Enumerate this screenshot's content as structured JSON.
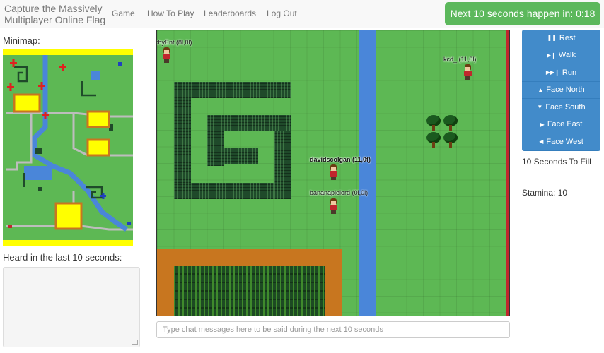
{
  "navbar": {
    "brand": "Capture the Massively Multiplayer Online Flag",
    "links": [
      "Game",
      "How To Play",
      "Leaderboards",
      "Log Out"
    ],
    "timer_label": "Next 10 seconds happen in:",
    "timer_value": "0:18"
  },
  "sidebar": {
    "minimap_label": "Minimap:",
    "heard_label": "Heard in the last 10 seconds:"
  },
  "map": {
    "players": [
      {
        "name": "AnarchyEnt",
        "coords": "(8l,0l)"
      },
      {
        "name": "kcd_",
        "coords": "(11,0l)"
      },
      {
        "name": "davidscolgan",
        "coords": "(11,0t)"
      },
      {
        "name": "bananapielord",
        "coords": "(0l,0l)"
      }
    ]
  },
  "chat": {
    "placeholder": "Type chat messages here to be said during the next 10 seconds"
  },
  "controls": {
    "buttons": [
      {
        "icon": "pause-icon",
        "label": "Rest"
      },
      {
        "icon": "step-forward-icon",
        "label": "Walk"
      },
      {
        "icon": "fast-forward-icon",
        "label": "Run"
      },
      {
        "icon": "chevron-up-icon",
        "label": "Face North"
      },
      {
        "icon": "chevron-down-icon",
        "label": "Face South"
      },
      {
        "icon": "chevron-right-icon",
        "label": "Face East"
      },
      {
        "icon": "chevron-left-icon",
        "label": "Face West"
      }
    ],
    "fill_label": "10 Seconds To Fill",
    "stamina_label": "Stamina: 10"
  },
  "colors": {
    "grass": "#5db854",
    "river": "#4a86d9",
    "timer": "#5cb85c",
    "button": "#428bca",
    "dirt": "#c8761f"
  }
}
